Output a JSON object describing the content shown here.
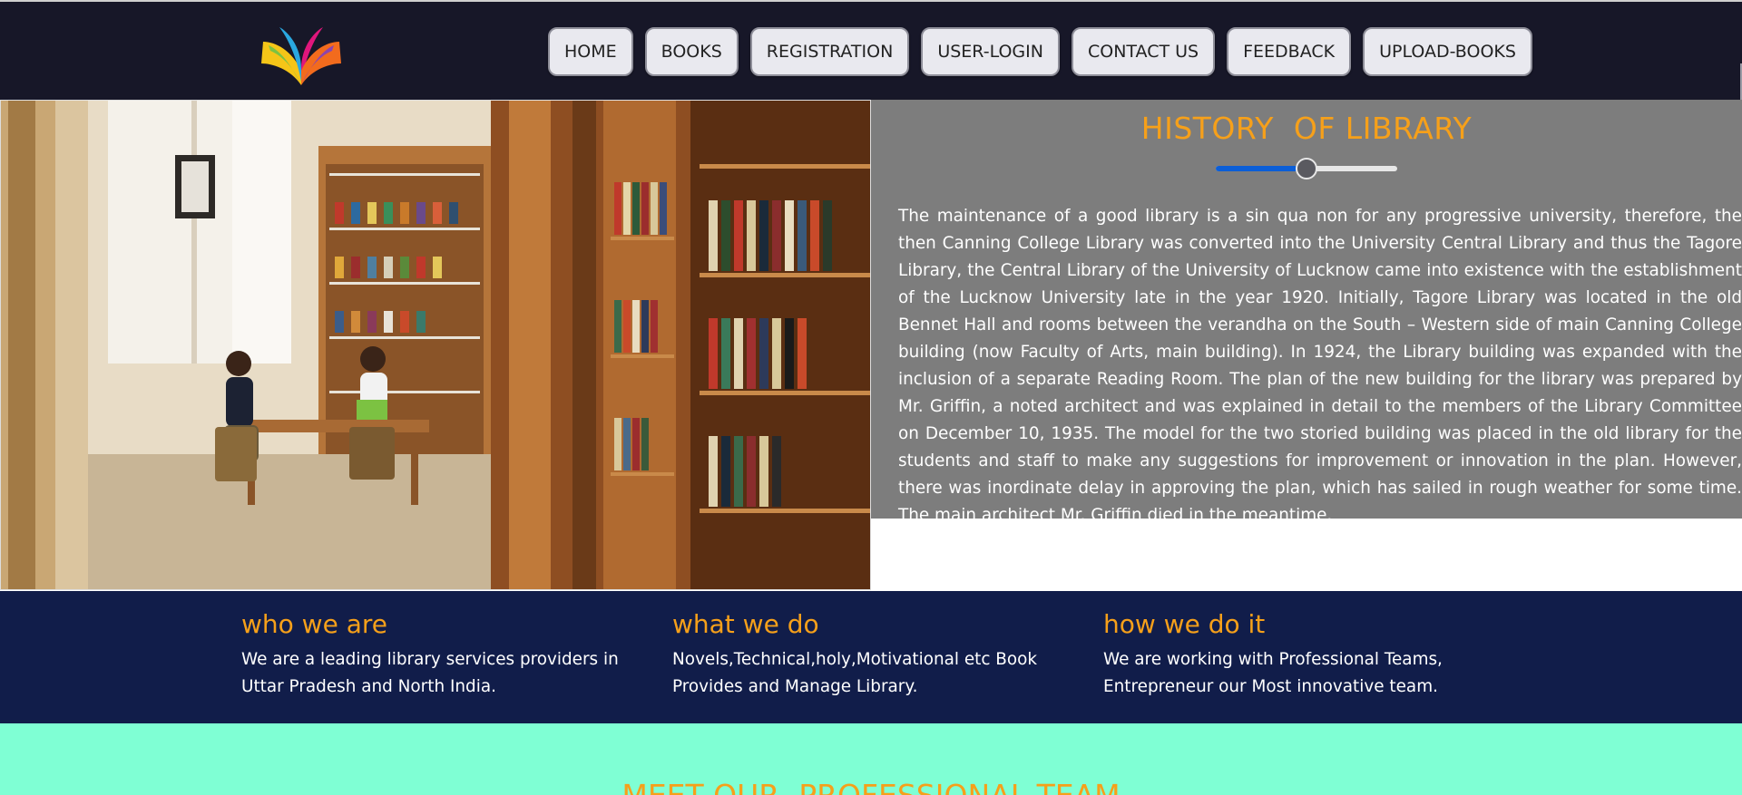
{
  "nav": {
    "items": [
      {
        "label": "HOME"
      },
      {
        "label": "BOOKS"
      },
      {
        "label": "REGISTRATION"
      },
      {
        "label": "USER-LOGIN"
      },
      {
        "label": "CONTACT US"
      },
      {
        "label": "FEEDBACK"
      },
      {
        "label": "UPLOAD-BOOKS"
      }
    ]
  },
  "logo": {
    "icon": "open-book-logo",
    "colors": [
      "#f5c518",
      "#2aa8e0",
      "#e0167c",
      "#f26b1d"
    ]
  },
  "hero": {
    "image": "library-reading-room-photo"
  },
  "history": {
    "title": "HISTORY  OF LIBRARY",
    "slider_value": 0.5,
    "text": "The maintenance of a good library is a sin qua non for any progressive university, therefore, the then Canning College Library was converted into the University Central Library and thus the Tagore Library, the Central Library of the University of Lucknow came into existence with the establishment of the Lucknow University late in the year 1920. Initially, Tagore Library was located in the old Bennet Hall and rooms between the verandha on the South – Western side of main Canning College building (now Faculty of Arts, main building). In 1924, the Library building was expanded with the inclusion of a separate Reading Room. The plan of the new building for the library was prepared by Mr. Griffin, a noted architect and was explained in detail to the members of the Library Committee on December 10, 1935. The model for the two storied building was placed in the old library for the students and staff to make any suggestions for improvement or innovation in the plan. However, there was inordinate delay in approving the plan, which has sailed in rough weather for some time. The main architect Mr. Griffin died in the meantime."
  },
  "info": {
    "columns": [
      {
        "heading": "who we are",
        "text": "We are a leading library services providers in Uttar Pradesh and North India."
      },
      {
        "heading": "what we do",
        "text": "Novels,Technical,holy,Motivational etc Book Provides and Manage Library."
      },
      {
        "heading": "how we do it",
        "text": "We are working with Professional Teams, Entrepreneur our Most innovative team."
      }
    ]
  },
  "team": {
    "title": "MEET OUR  PROFESSIONAL TEAM"
  },
  "colors": {
    "accent": "#f6a01a",
    "topbar": "#171728",
    "info_band": "#111d4a",
    "team_band": "#7fffd4",
    "history_bg": "#7d7d7d"
  }
}
